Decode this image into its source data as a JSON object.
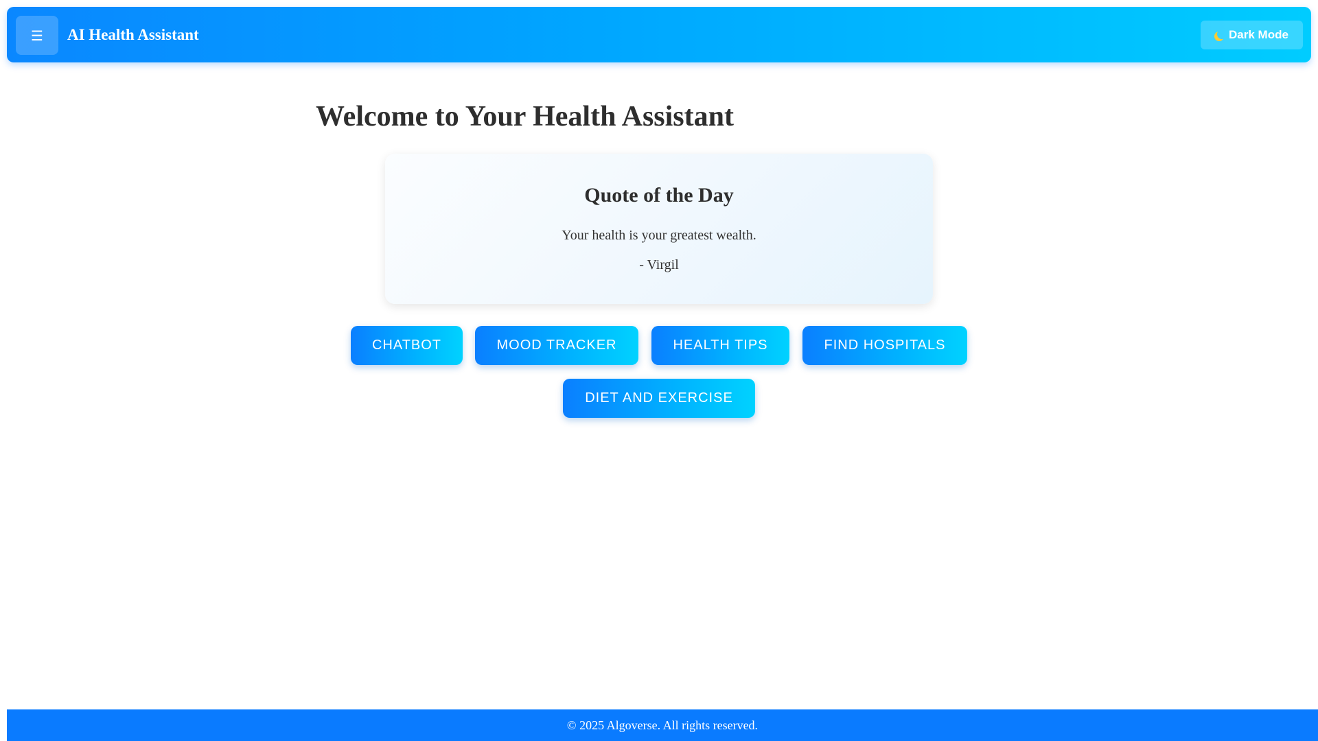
{
  "header": {
    "menu_icon_glyph": "☰",
    "title": "AI Health Assistant",
    "dark_mode_label": "Dark Mode",
    "dark_mode_icon": "moon-icon"
  },
  "main": {
    "welcome_title": "Welcome to Your Health Assistant",
    "quote": {
      "heading": "Quote of the Day",
      "text": "Your health is your greatest wealth.",
      "author": "- Virgil"
    },
    "buttons": [
      {
        "label": "CHATBOT"
      },
      {
        "label": "MOOD TRACKER"
      },
      {
        "label": "HEALTH TIPS"
      },
      {
        "label": "FIND HOSPITALS"
      },
      {
        "label": "DIET AND EXERCISE"
      }
    ]
  },
  "footer": {
    "text": "© 2025 Algoverse. All rights reserved."
  },
  "colors": {
    "header_gradient_start": "#0a87ff",
    "header_gradient_end": "#00ccff",
    "button_gradient_start": "#0a7fff",
    "button_gradient_end": "#00d2ff",
    "footer_background": "#0a7bff",
    "text_dark": "#2e2e2e"
  }
}
